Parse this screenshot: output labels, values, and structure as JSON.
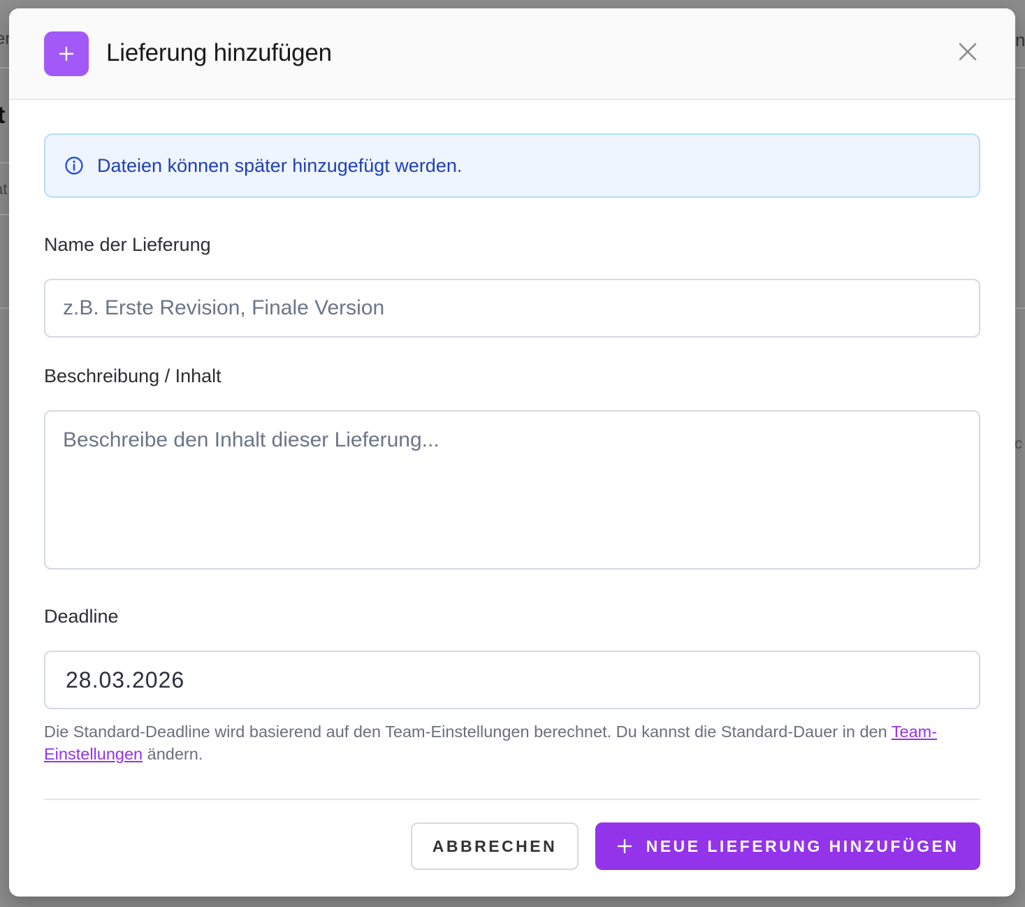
{
  "background": {
    "glyph_top_left": "er",
    "glyph_title_left": "t",
    "glyph_row_left": "at",
    "glyph_top_right": "n",
    "glyph_mid_right": "c"
  },
  "modal": {
    "title": "Lieferung hinzufügen",
    "header_icon": "plus-icon",
    "close_icon": "close-icon",
    "accent_color": "#9333ea"
  },
  "info": {
    "icon": "info-icon",
    "text": "Dateien können später hinzugefügt werden."
  },
  "form": {
    "name": {
      "label": "Name der Lieferung",
      "value": "",
      "placeholder": "z.B. Erste Revision, Finale Version"
    },
    "description": {
      "label": "Beschreibung / Inhalt",
      "value": "",
      "placeholder": "Beschreibe den Inhalt dieser Lieferung..."
    },
    "deadline": {
      "label": "Deadline",
      "value": "28.03.2026",
      "helper_before": "Die Standard-Deadline wird basierend auf den Team-Einstellungen berechnet. Du kannst die Standard-Dauer in den ",
      "helper_link": "Team-Einstellungen",
      "helper_after": " ändern."
    }
  },
  "actions": {
    "cancel_label": "ABBRECHEN",
    "submit_label": "NEUE LIEFERUNG HINZUFÜGEN"
  }
}
